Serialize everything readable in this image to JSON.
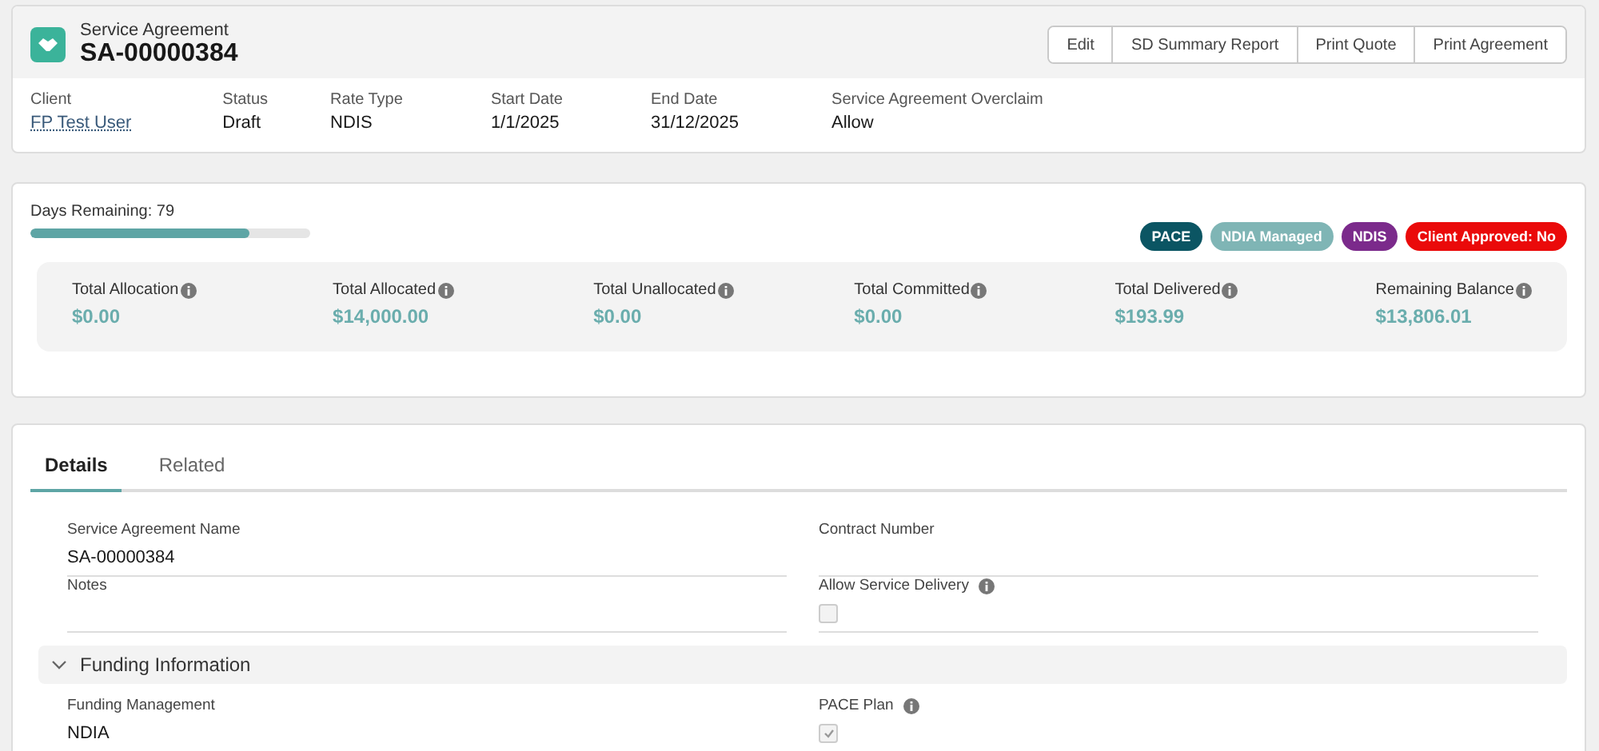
{
  "header": {
    "object_type": "Service Agreement",
    "title": "SA-00000384",
    "buttons": [
      "Edit",
      "SD Summary Report",
      "Print Quote",
      "Print Agreement"
    ],
    "highlights": [
      {
        "label": "Client",
        "value": "FP Test User",
        "kind": "link"
      },
      {
        "label": "Status",
        "value": "Draft",
        "kind": "text"
      },
      {
        "label": "Rate Type",
        "value": "NDIS",
        "kind": "text"
      },
      {
        "label": "Start Date",
        "value": "1/1/2025",
        "kind": "text"
      },
      {
        "label": "End Date",
        "value": "31/12/2025",
        "kind": "text"
      },
      {
        "label": "Service Agreement Overclaim",
        "value": "Allow",
        "kind": "text"
      }
    ]
  },
  "summary": {
    "days_remaining": "Days Remaining: 79",
    "level": 0.78,
    "badges": [
      {
        "label": "PACE",
        "color": "#0b5563"
      },
      {
        "label": "NDIA Managed",
        "color": "#7fb5b5"
      },
      {
        "label": "NDIS",
        "color": "#7b2a8b"
      },
      {
        "label": "Client Approved: No",
        "color": "#ea0a0a"
      }
    ],
    "totals": [
      {
        "label": "Total Allocation",
        "value": "$0.00"
      },
      {
        "label": "Total Allocated",
        "value": "$14,000.00"
      },
      {
        "label": "Total Unallocated",
        "value": "$0.00"
      },
      {
        "label": "Total Committed",
        "value": "$0.00"
      },
      {
        "label": "Total Delivered",
        "value": "$193.99"
      },
      {
        "label": "Remaining Balance",
        "value": "$13,806.01"
      }
    ]
  },
  "tabs": [
    {
      "label": "Details",
      "selected": true
    },
    {
      "label": "Related",
      "selected": false
    }
  ],
  "fields": [
    {
      "label": "Service Agreement Name",
      "value": "SA-00000384",
      "kind": "text"
    },
    {
      "label": "Contract Number",
      "kind": "text"
    },
    {
      "label": "Notes",
      "kind": "text"
    },
    {
      "label": "Allow Service Delivery",
      "kind": "checkbox",
      "info": true,
      "checked": false
    }
  ],
  "sections": [
    {
      "title": "Funding Information",
      "expanded": true,
      "fields": [
        {
          "label": "Funding Management",
          "value": "NDIA",
          "kind": "text"
        },
        {
          "label": "PACE Plan",
          "kind": "checkbox",
          "info": true,
          "checked": true
        }
      ]
    }
  ]
}
